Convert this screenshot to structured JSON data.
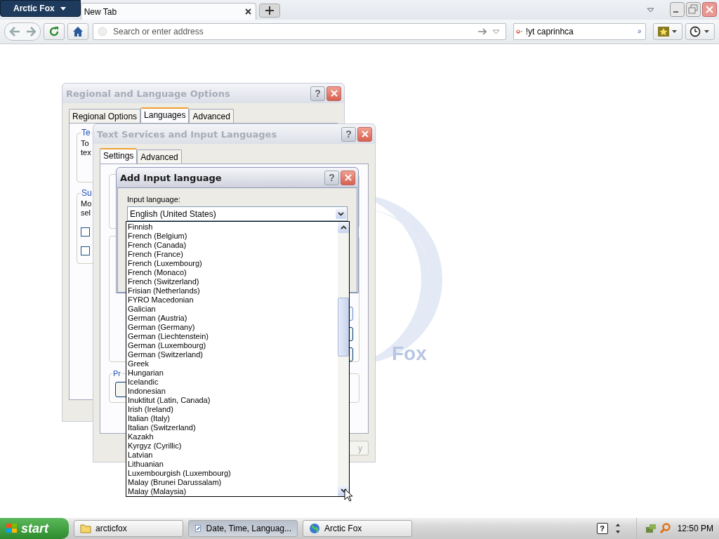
{
  "browser": {
    "app_menu": "Arctic Fox",
    "tabs": [
      {
        "label": "New Tab",
        "selected": true
      }
    ],
    "address": {
      "placeholder": "Search or enter address"
    },
    "search": {
      "value": "!yt caprinhca"
    }
  },
  "logo": {
    "text": "Fox"
  },
  "regional_window": {
    "title": "Regional and Language Options",
    "help": "?",
    "tabs": [
      {
        "label": "Regional Options",
        "selected": false
      },
      {
        "label": "Languages",
        "selected": true
      },
      {
        "label": "Advanced",
        "selected": false
      }
    ],
    "group_1": {
      "label": "Te",
      "lines": [
        "To",
        "tex"
      ]
    },
    "group_2": {
      "label": "Su",
      "lines": [
        "Mo",
        "sel"
      ],
      "checkboxes": [
        {
          "checked": false
        },
        {
          "checked": false
        }
      ]
    }
  },
  "text_services_window": {
    "title": "Text Services and Input Languages",
    "help": "?",
    "tabs": [
      {
        "label": "Settings",
        "selected": true
      },
      {
        "label": "Advanced",
        "selected": false
      }
    ],
    "group_3": {
      "label": "Pr"
    },
    "apply_button": "y"
  },
  "add_language_dialog": {
    "title": "Add Input language",
    "help": "?",
    "label": "Input language:",
    "value": "English (United States)",
    "options": [
      "Finnish",
      "French (Belgium)",
      "French (Canada)",
      "French (France)",
      "French (Luxembourg)",
      "French (Monaco)",
      "French (Switzerland)",
      "Frisian (Netherlands)",
      "FYRO Macedonian",
      "Galician",
      "German (Austria)",
      "German (Germany)",
      "German (Liechtenstein)",
      "German (Luxembourg)",
      "German (Switzerland)",
      "Greek",
      "Hungarian",
      "Icelandic",
      "Indonesian",
      "Inuktitut (Latin, Canada)",
      "Irish (Ireland)",
      "Italian (Italy)",
      "Italian (Switzerland)",
      "Kazakh",
      "Kyrgyz (Cyrillic)",
      "Latvian",
      "Lithuanian",
      "Luxembourgish (Luxembourg)",
      "Malay (Brunei Darussalam)",
      "Malay (Malaysia)"
    ]
  },
  "taskbar": {
    "start": "start",
    "items": [
      {
        "label": "arcticfox",
        "kind": "folder",
        "selected": false
      },
      {
        "label": "Date, Time, Languag...",
        "kind": "settings",
        "selected": true
      },
      {
        "label": "Arctic Fox",
        "kind": "browser",
        "selected": false
      }
    ],
    "tray_help": "?",
    "clock": "12:50 PM"
  }
}
